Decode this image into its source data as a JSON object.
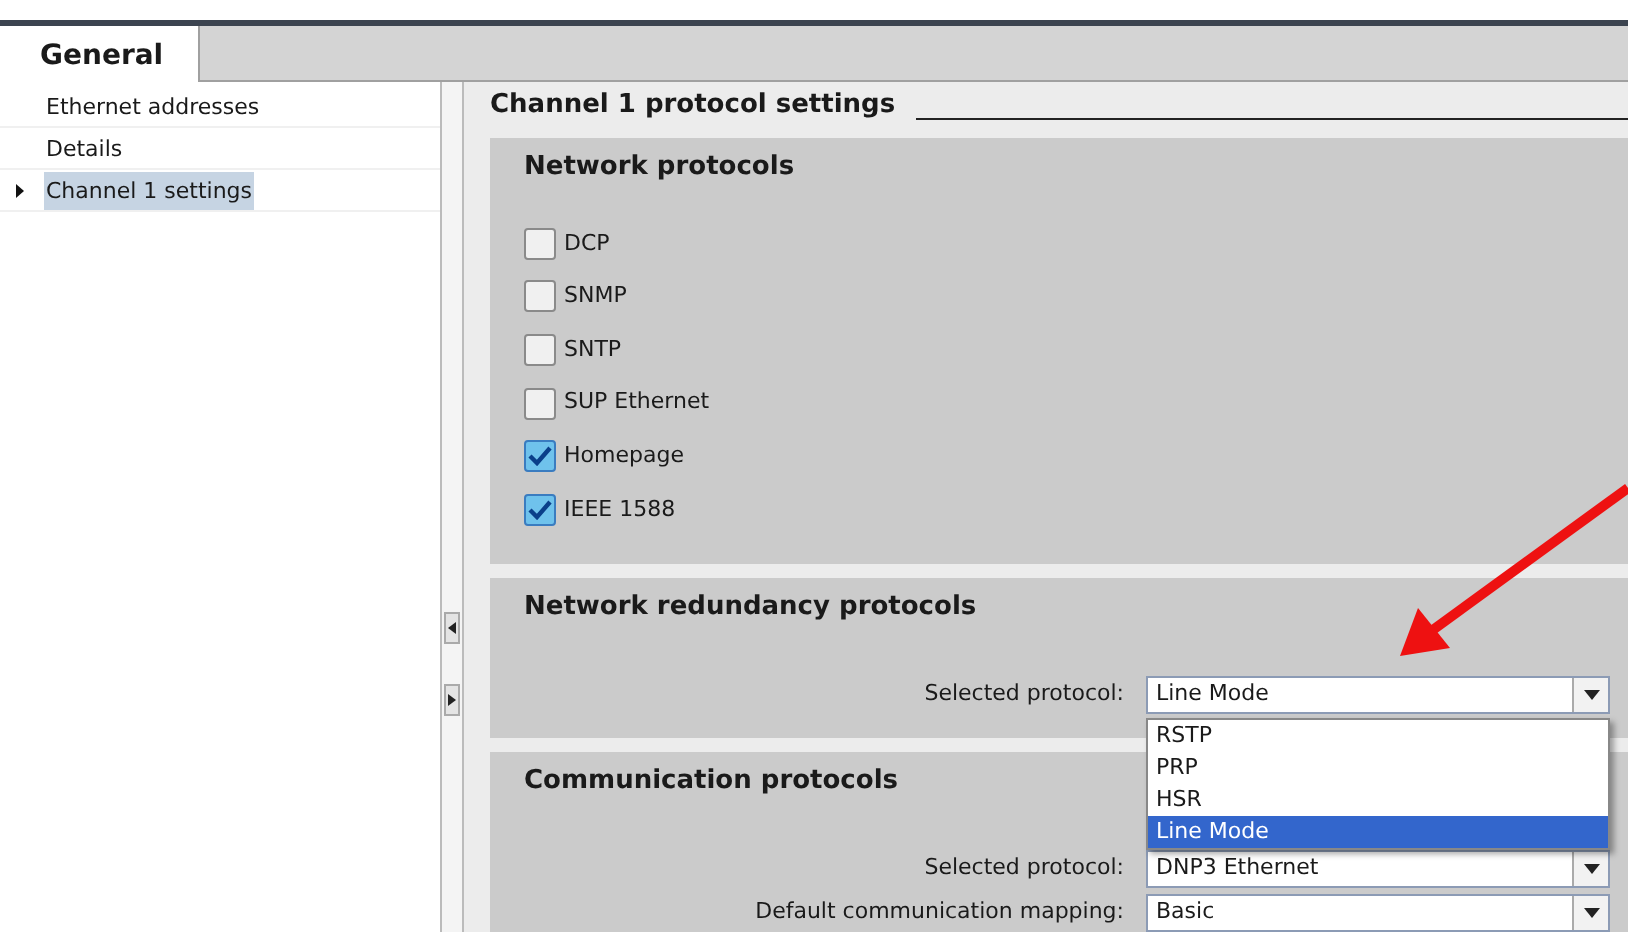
{
  "tabs": [
    {
      "label": "General",
      "selected": true
    }
  ],
  "sidebar": {
    "items": [
      {
        "label": "Ethernet addresses",
        "selected": false
      },
      {
        "label": "Details",
        "selected": false
      },
      {
        "label": "Channel 1 settings",
        "selected": true
      }
    ]
  },
  "content": {
    "title": "Channel 1 protocol settings",
    "network_protocols": {
      "title": "Network protocols",
      "options": [
        {
          "label": "DCP",
          "checked": false
        },
        {
          "label": "SNMP",
          "checked": false
        },
        {
          "label": "SNTP",
          "checked": false
        },
        {
          "label": "SUP Ethernet",
          "checked": false
        },
        {
          "label": "Homepage",
          "checked": true
        },
        {
          "label": "IEEE 1588",
          "checked": true
        }
      ]
    },
    "redundancy": {
      "title": "Network redundancy protocols",
      "label": "Selected protocol:",
      "value": "Line Mode",
      "expanded": true,
      "options": [
        {
          "label": "RSTP",
          "selected": false
        },
        {
          "label": "PRP",
          "selected": false
        },
        {
          "label": "HSR",
          "selected": false
        },
        {
          "label": "Line Mode",
          "selected": true
        }
      ]
    },
    "communication": {
      "title": "Communication protocols",
      "fields": [
        {
          "label": "Selected protocol:",
          "value": "DNP3 Ethernet"
        },
        {
          "label": "Default communication mapping:",
          "value": "Basic"
        }
      ]
    }
  }
}
